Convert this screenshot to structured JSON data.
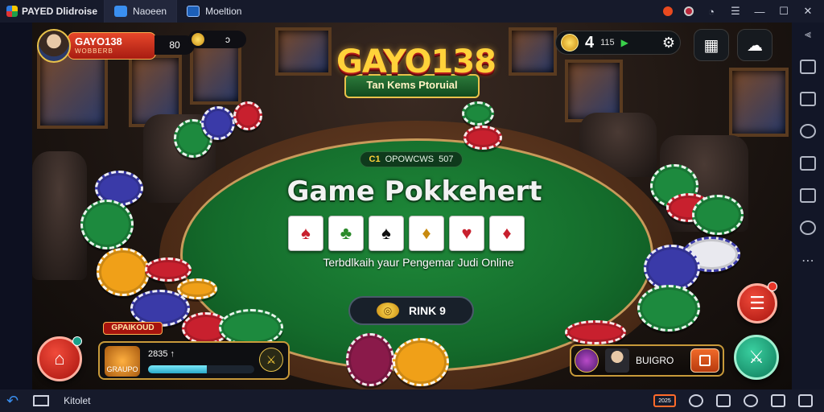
{
  "window": {
    "app_name": "PAYED Dlidroise",
    "tabs": [
      {
        "label": "Naoeen",
        "icon": "app-tab-icon"
      },
      {
        "label": "Moeltion",
        "icon": "image-tab-icon"
      }
    ],
    "controls": [
      "notification-icon",
      "account-icon",
      "help-icon",
      "menu-icon",
      "minimize-icon",
      "maximize-icon",
      "close-icon"
    ]
  },
  "game": {
    "logo_text": "GAYO138",
    "logo_sub": "Tan Kems Ptoruial",
    "pot": {
      "left": "C1",
      "text": "OPOWCWS",
      "value": "507"
    },
    "headline": "Game Pokkehert",
    "subline": "Terbdlkaih yaur Pengemar Judi Online",
    "cards": [
      "♠",
      "♣",
      "♠",
      "♦",
      "♥",
      "♦"
    ],
    "rank_button": {
      "icon_text": "◎",
      "label": "RINK 9"
    }
  },
  "player": {
    "name": "GAYO138",
    "club": "WOBBERB",
    "score": "80",
    "coins_label": "ↄ"
  },
  "hud": {
    "balance_big": "4",
    "balance_small": "115",
    "arrow": "▶",
    "gear": "⚙"
  },
  "bottom_left": {
    "label": "GPAIKOUD",
    "icon_text": "GRAUPO",
    "value": "2835",
    "marker": "↑",
    "progress": 0.55,
    "action_icon": "⚔"
  },
  "bottom_right": {
    "name": "BUIGRO"
  },
  "navbar": {
    "back": "↶",
    "label": "Kitolet",
    "highlight": "2025"
  },
  "colors": {
    "felt": "#1f8a3a",
    "logo_gold": "#ffd23a",
    "accent_red": "#e6472a",
    "accent_green": "#3ad0a0"
  }
}
